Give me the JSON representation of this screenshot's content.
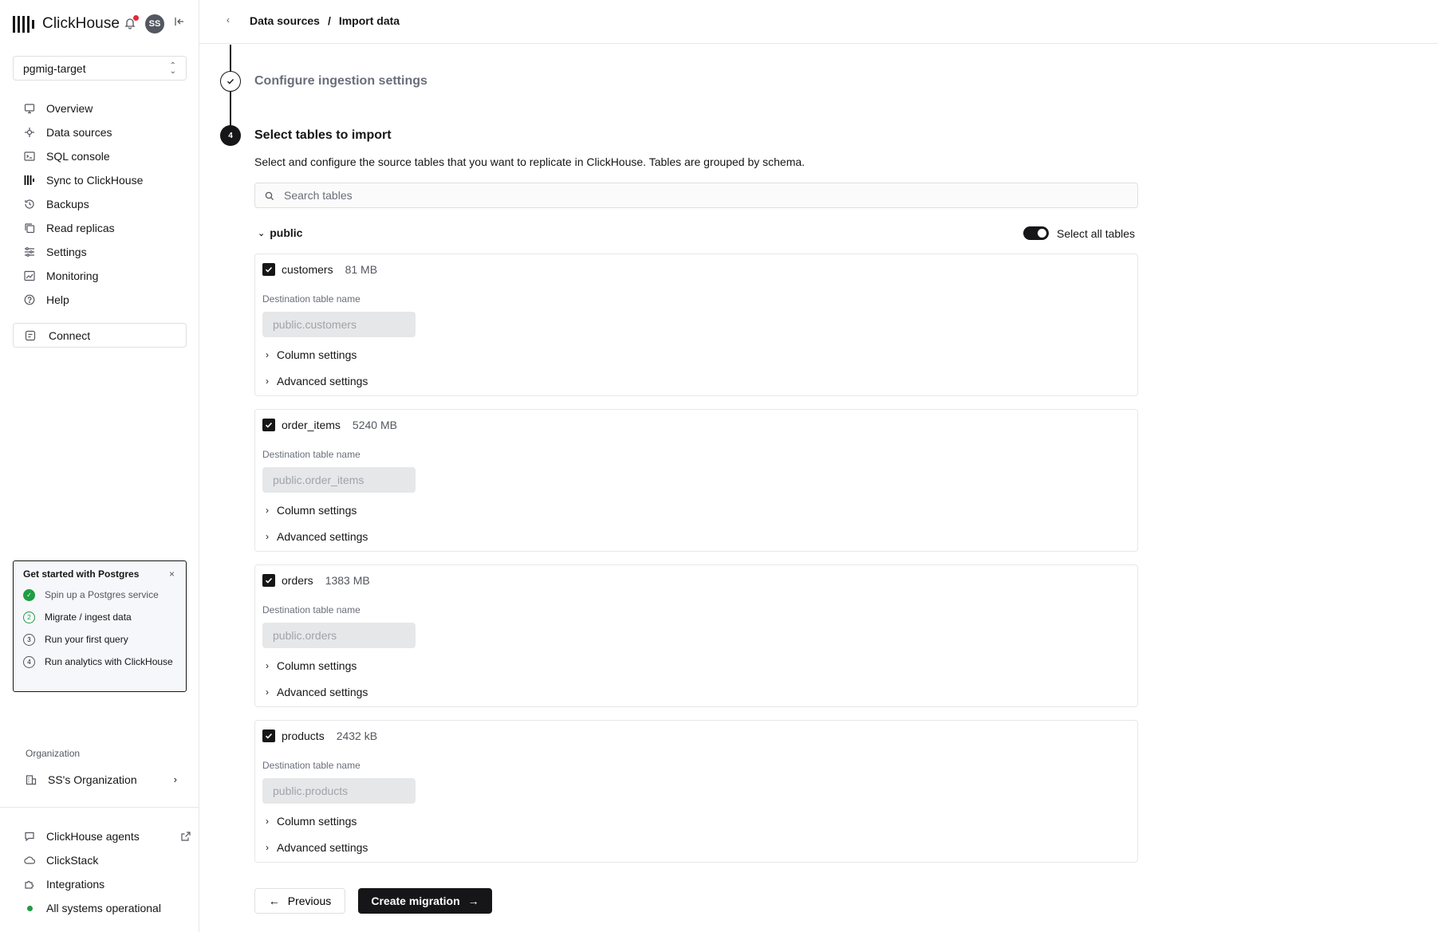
{
  "app": {
    "brand": "ClickHouse",
    "avatar_initials": "SS"
  },
  "service_selector": {
    "value": "pgmig-target"
  },
  "nav": {
    "items": [
      {
        "label": "Overview",
        "icon": "monitor-icon"
      },
      {
        "label": "Data sources",
        "icon": "plug-icon"
      },
      {
        "label": "SQL console",
        "icon": "terminal-icon"
      },
      {
        "label": "Sync to ClickHouse",
        "icon": "bars-icon"
      },
      {
        "label": "Backups",
        "icon": "history-icon"
      },
      {
        "label": "Read replicas",
        "icon": "copy-icon"
      },
      {
        "label": "Settings",
        "icon": "sliders-icon"
      },
      {
        "label": "Monitoring",
        "icon": "chart-icon"
      },
      {
        "label": "Help",
        "icon": "help-icon"
      }
    ],
    "connect_label": "Connect"
  },
  "get_started": {
    "title": "Get started with Postgres",
    "close_glyph": "×",
    "steps": [
      {
        "num": "✓",
        "label": "Spin up a Postgres service",
        "status": "done"
      },
      {
        "num": "2",
        "label": "Migrate / ingest data",
        "status": "active"
      },
      {
        "num": "3",
        "label": "Run your first query",
        "status": "todo"
      },
      {
        "num": "4",
        "label": "Run analytics with ClickHouse",
        "status": "todo"
      }
    ]
  },
  "organization": {
    "label": "Organization",
    "name": "SS's Organization"
  },
  "bottom_nav": {
    "agents": "ClickHouse agents",
    "clickstack": "ClickStack",
    "integrations": "Integrations",
    "status": "All systems operational"
  },
  "header": {
    "crumb1": "Data sources",
    "separator": "/",
    "crumb2": "Import data"
  },
  "stepper": {
    "done_step_title": "Configure ingestion settings",
    "current_step_number": "4",
    "current_step_title": "Select tables to import",
    "description": "Select and configure the source tables that you want to replicate in ClickHouse. Tables are grouped by schema."
  },
  "search": {
    "placeholder": "Search tables"
  },
  "schema": {
    "name": "public",
    "select_all_label": "Select all tables",
    "select_all_on": true
  },
  "tables": [
    {
      "name": "customers",
      "size": "81 MB",
      "dest_label": "Destination table name",
      "dest_value": "public.customers",
      "column_settings": "Column settings",
      "advanced_settings": "Advanced settings",
      "checked": true
    },
    {
      "name": "order_items",
      "size": "5240 MB",
      "dest_label": "Destination table name",
      "dest_value": "public.order_items",
      "column_settings": "Column settings",
      "advanced_settings": "Advanced settings",
      "checked": true
    },
    {
      "name": "orders",
      "size": "1383 MB",
      "dest_label": "Destination table name",
      "dest_value": "public.orders",
      "column_settings": "Column settings",
      "advanced_settings": "Advanced settings",
      "checked": true
    },
    {
      "name": "products",
      "size": "2432 kB",
      "dest_label": "Destination table name",
      "dest_value": "public.products",
      "column_settings": "Column settings",
      "advanced_settings": "Advanced settings",
      "checked": true
    }
  ],
  "actions": {
    "previous": "Previous",
    "create": "Create migration"
  },
  "colors": {
    "accent": "#161517",
    "success": "#1f9d44",
    "notification": "#e5283c"
  }
}
